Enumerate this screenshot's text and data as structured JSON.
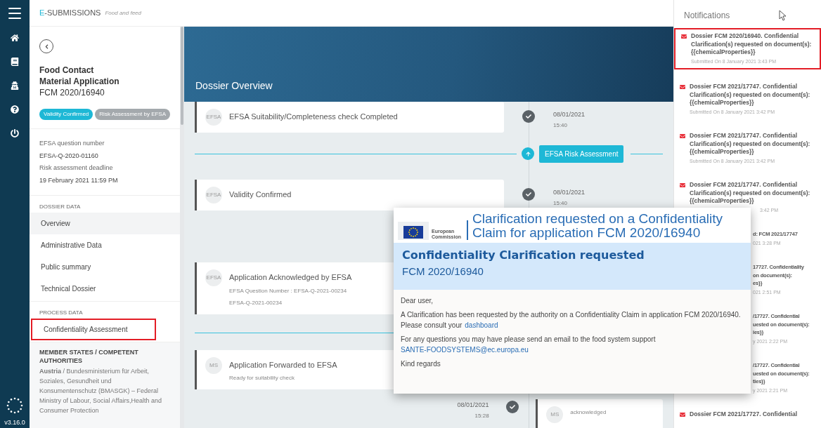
{
  "app": {
    "brand_accent": "E",
    "brand": "-SUBMISSIONS",
    "tagline": "Food and feed",
    "version": "v3.16.0"
  },
  "rail": {
    "items": [
      {
        "kind": "home"
      },
      {
        "kind": "book"
      },
      {
        "kind": "agent"
      },
      {
        "kind": "help"
      },
      {
        "kind": "power"
      }
    ]
  },
  "sidebar": {
    "title": "Food Contact Material Application",
    "reference": "FCM 2020/16940",
    "badges": [
      {
        "label": "Validity Confirmed",
        "color": "#1eb8d6"
      },
      {
        "label": "Risk Assessment by EFSA",
        "color": "#a4a9ad"
      }
    ],
    "info": [
      {
        "label": "EFSA question number",
        "value": "EFSA-Q-2020-01160"
      },
      {
        "label": "Risk assessment deadline",
        "value": "19 February 2021 11:59 PM"
      }
    ],
    "sections": [
      {
        "heading": "DOSSIER DATA",
        "items": [
          {
            "label": "Overview",
            "selected": true,
            "highlighted": false
          },
          {
            "label": "Administrative Data",
            "selected": false,
            "highlighted": false
          },
          {
            "label": "Public summary",
            "selected": false,
            "highlighted": false
          },
          {
            "label": "Technical Dossier",
            "selected": false,
            "highlighted": false
          }
        ]
      },
      {
        "heading": "PROCESS DATA",
        "items": [
          {
            "label": "Confidentiality Assessment",
            "selected": false,
            "highlighted": true
          }
        ]
      }
    ],
    "authorities": {
      "heading": "MEMBER STATES / COMPETENT AUTHORITIES",
      "text": "**Austria** / Bundesministerium für Arbeit, Soziales, Gesundheit und Konsumentenschutz (BMASGK) – Federal Ministry of Labour, Social Affairs,Health and Consumer Protection"
    }
  },
  "overview": {
    "title": "Dossier Overview",
    "timeline": [
      {
        "kind": "event",
        "badge": "EFSA",
        "title": "EFSA Suitability/Completeness check Completed",
        "date": "08/01/2021",
        "time": "15:40"
      },
      {
        "kind": "milestone",
        "label": "EFSA Risk Assessment"
      },
      {
        "kind": "event",
        "badge": "EFSA",
        "title": "Validity Confirmed",
        "date": "08/01/2021",
        "time": "15:40"
      },
      {
        "kind": "event",
        "badge": "EFSA",
        "title": "Application Acknowledged by EFSA",
        "lines": [
          "EFSA Question Number : EFSA-Q-2021-00234",
          "EFSA-Q-2021-00234"
        ]
      },
      {
        "kind": "divider"
      },
      {
        "kind": "event",
        "badge": "MS",
        "title": "Application Forwarded to EFSA",
        "lines": [
          "Ready for suitability check"
        ]
      },
      {
        "kind": "reply",
        "badge": "MS",
        "lines": [
          "acknowledged"
        ],
        "date": "08/01/2021",
        "time": "15:28"
      }
    ]
  },
  "notifications": {
    "title": "Notifications",
    "items": [
      {
        "kind": "full",
        "highlighted": true,
        "lines": [
          "Dossier FCM 2020/16940. Confidential Clarification(s) requested on document(s): {{chemicalProperties}}"
        ],
        "time": "Submitted On 8 January 2021 3:43 PM"
      },
      {
        "kind": "full",
        "highlighted": false,
        "lines": [
          "Dossier FCM 2021/17747. Confidential Clarification(s) requested on document(s): {{chemicalProperties}}"
        ],
        "time": "Submitted On 8 January 2021 3:42 PM"
      },
      {
        "kind": "full",
        "highlighted": false,
        "lines": [
          "Dossier FCM 2021/17747. Confidential Clarification(s) requested on document(s): {{chemicalProperties}}"
        ],
        "time": "Submitted On 8 January 2021 3:42 PM"
      },
      {
        "kind": "overlapped",
        "highlighted": false,
        "lines": [
          "Dossier FCM 2021/17747. Confidential Clarification(s) requested on document(s): {{chemicalProperties}}"
        ],
        "time": "3:42 PM"
      },
      {
        "kind": "partial",
        "highlighted": false,
        "lines": [
          "d: FCM 2021/17747"
        ],
        "time": "021 3:28 PM"
      },
      {
        "kind": "partial",
        "highlighted": false,
        "lines": [
          "17727. Confidentiality",
          "on document(s):",
          "es}}"
        ],
        "time": "021 2:51 PM"
      },
      {
        "kind": "partial",
        "highlighted": false,
        "lines": [
          "/17727. Confidential",
          "uested on document(s):",
          "ies}}"
        ],
        "time": "y 2021 2:22 PM"
      },
      {
        "kind": "partial",
        "highlighted": false,
        "lines": [
          "/17727. Confidential",
          "uested on document(s):",
          "ties}}"
        ],
        "time": "y 2021 2:21 PM"
      },
      {
        "kind": "full",
        "highlighted": false,
        "lines": [
          "Dossier FCM 2021/17727. Confidential"
        ]
      }
    ]
  },
  "email": {
    "logo_text": "European Commission",
    "subject": "Clarification requested on a Confidentiality Claim for application FCM 2020/16940",
    "heading": "Confidentiality Clarification requested",
    "reference": "FCM 2020/16940",
    "greeting": "Dear user,",
    "body": "A Clarification has been requested by the authority on a Confidentiality Claim in application FCM 2020/16940.",
    "consult": "Please consult your",
    "consult_link": "dashboard",
    "questions": "For any questions you may have please send an email to the food system support",
    "address": "SANTE-FOODSYSTEMS@ec.europa.eu",
    "closing": "Kind regards"
  }
}
